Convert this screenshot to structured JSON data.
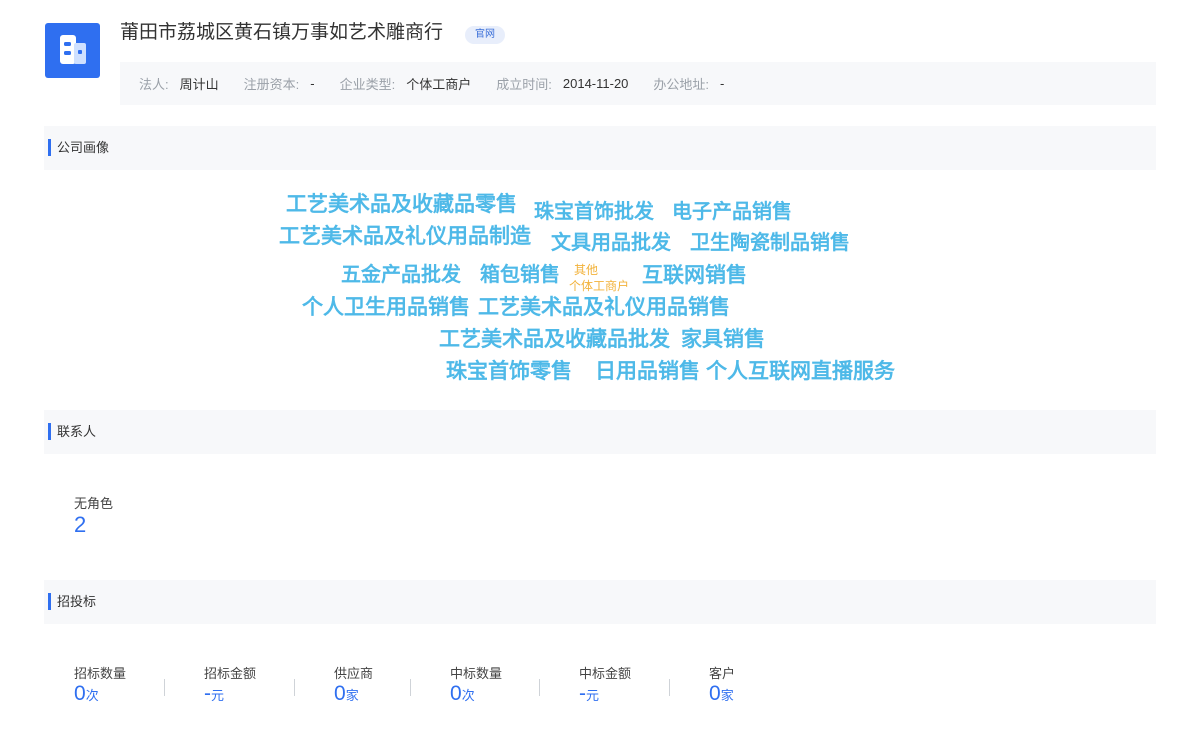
{
  "company": {
    "name": "莆田市荔城区黄石镇万事如艺术雕商行",
    "tag": "官网"
  },
  "info": {
    "legal_label": "法人:",
    "legal_value": "周计山",
    "capital_label": "注册资本:",
    "capital_value": "-",
    "type_label": "企业类型:",
    "type_value": "个体工商户",
    "founded_label": "成立时间:",
    "founded_value": "2014-11-20",
    "address_label": "办公地址:",
    "address_value": "-"
  },
  "portrait": {
    "title": "公司画像",
    "words": [
      "工艺美术品及收藏品零售",
      "珠宝首饰批发",
      "电子产品销售",
      "工艺美术品及礼仪用品制造",
      "文具用品批发",
      "卫生陶瓷制品销售",
      "五金产品批发",
      "箱包销售",
      "其他",
      "个体工商户",
      "互联网销售",
      "个人卫生用品销售",
      "工艺美术品及礼仪用品销售",
      "工艺美术品及收藏品批发",
      "家具销售",
      "珠宝首饰零售",
      "日用品销售",
      "个人互联网直播服务"
    ],
    "colors": {
      "main": "#4eb9e8",
      "accent": "#f2b23a"
    }
  },
  "contacts": {
    "title": "联系人",
    "role_label": "无角色",
    "role_count": "2"
  },
  "bidding": {
    "title": "招投标",
    "stats": [
      {
        "label": "招标数量",
        "value": "0",
        "unit": "次"
      },
      {
        "label": "招标金额",
        "value": "-",
        "unit": "元"
      },
      {
        "label": "供应商",
        "value": "0",
        "unit": "家"
      },
      {
        "label": "中标数量",
        "value": "0",
        "unit": "次"
      },
      {
        "label": "中标金额",
        "value": "-",
        "unit": "元"
      },
      {
        "label": "客户",
        "value": "0",
        "unit": "家"
      }
    ]
  },
  "colors": {
    "accent": "#2f6ff0",
    "section_bg": "#f7f8fa"
  }
}
